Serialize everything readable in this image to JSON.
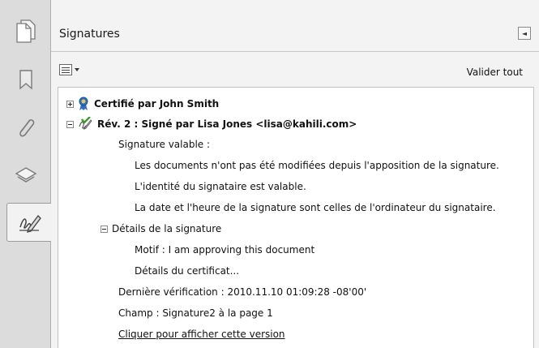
{
  "sidebar": {
    "buttons": [
      {
        "icon": "pages-icon"
      },
      {
        "icon": "bookmark-icon"
      },
      {
        "icon": "paperclip-icon"
      },
      {
        "icon": "layers-icon"
      },
      {
        "icon": "signature-icon",
        "active": true
      }
    ]
  },
  "panel": {
    "title": "Signatures",
    "collapse_glyph": "◄",
    "validate_all": "Valider tout"
  },
  "tree": {
    "certified": "Certifié par John Smith",
    "revision": "Rév. 2 : Signé par Lisa Jones <lisa@kahili.com>",
    "signature_valid": "Signature valable :",
    "valid_1": "Les documents n'ont pas été modifiées depuis l'apposition de la signature.",
    "valid_2": "L'identité du signataire est valable.",
    "valid_3": "La date et l'heure de la signature sont celles de l'ordinateur du signataire.",
    "details_header": "Détails de la signature",
    "reason": "Motif : I am approving this document",
    "cert_details": "Détails du certificat...",
    "last_check": "Dernière vérification : 2010.11.10 01:09:28 -08'00'",
    "field": "Champ : Signature2 à la page 1",
    "view_version": "Cliquer pour afficher cette version"
  },
  "colors": {
    "sidebar_bg": "#dcdcdc",
    "panel_bg": "#f3f3f3",
    "ribbon_blue": "#2f6fc4",
    "check_green": "#3a9a2a"
  }
}
